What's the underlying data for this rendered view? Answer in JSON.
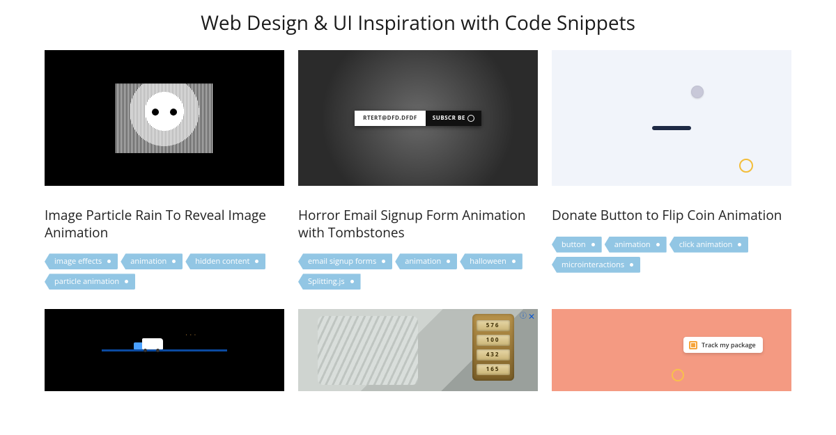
{
  "page_title": "Web Design & UI Inspiration with Code Snippets",
  "cards": [
    {
      "title": "Image Particle Rain To Reveal Image Animation",
      "tags": [
        "image effects",
        "animation",
        "hidden content",
        "particle animation"
      ],
      "thumb": {
        "kind": "particle-face"
      }
    },
    {
      "title": "Horror Email Signup Form Animation with Tombstones",
      "tags": [
        "email signup forms",
        "animation",
        "halloween",
        "Splitting.js"
      ],
      "thumb": {
        "kind": "email-form",
        "email_text": "RTERT@DFD.DFDF",
        "button_text": "SUBSCR BE"
      }
    },
    {
      "title": "Donate Button to Flip Coin Animation",
      "tags": [
        "button",
        "animation",
        "click animation",
        "microinteractions"
      ],
      "thumb": {
        "kind": "coin-flip"
      }
    },
    {
      "thumb": {
        "kind": "truck-loader"
      }
    },
    {
      "thumb": {
        "kind": "ad-lock",
        "dials": [
          "576",
          "100",
          "432",
          "165"
        ],
        "ad_info": "ⓘ",
        "ad_close": "✕"
      }
    },
    {
      "thumb": {
        "kind": "track-package",
        "pill_text": "Track my package"
      }
    }
  ]
}
